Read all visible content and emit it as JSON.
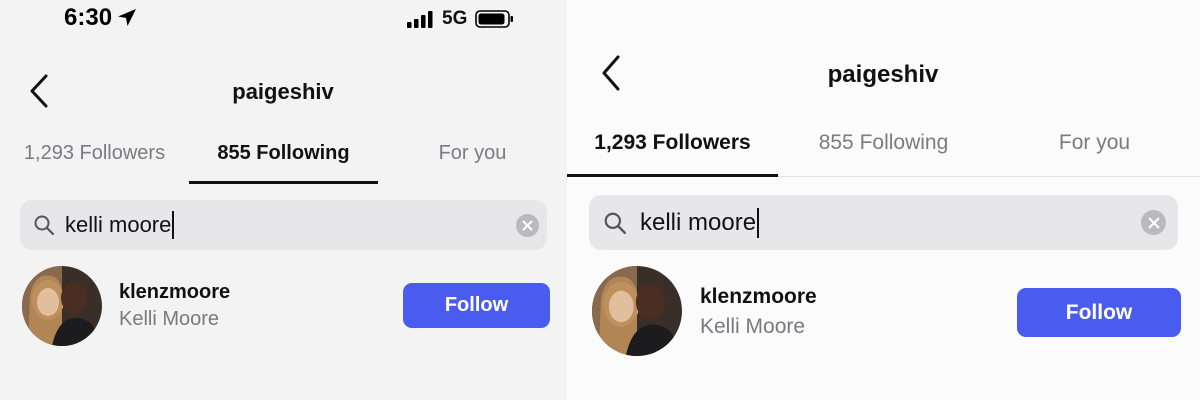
{
  "left": {
    "status": {
      "time": "6:30",
      "network": "5G"
    },
    "header": {
      "title": "paigeshiv"
    },
    "tabs": [
      {
        "label": "1,293 Followers",
        "active": false
      },
      {
        "label": "855 Following",
        "active": true
      },
      {
        "label": "For you",
        "active": false
      }
    ],
    "search": {
      "query": "kelli moore"
    },
    "result": {
      "username": "klenzmoore",
      "name": "Kelli Moore",
      "button": "Follow"
    }
  },
  "right": {
    "header": {
      "title": "paigeshiv"
    },
    "tabs": [
      {
        "label": "1,293 Followers",
        "active": true
      },
      {
        "label": "855 Following",
        "active": false
      },
      {
        "label": "For you",
        "active": false
      }
    ],
    "search": {
      "query": "kelli moore"
    },
    "result": {
      "username": "klenzmoore",
      "name": "Kelli Moore",
      "button": "Follow"
    }
  },
  "colors": {
    "follow_button": "#4a5cf0",
    "active_tab_underline": "#111111"
  }
}
